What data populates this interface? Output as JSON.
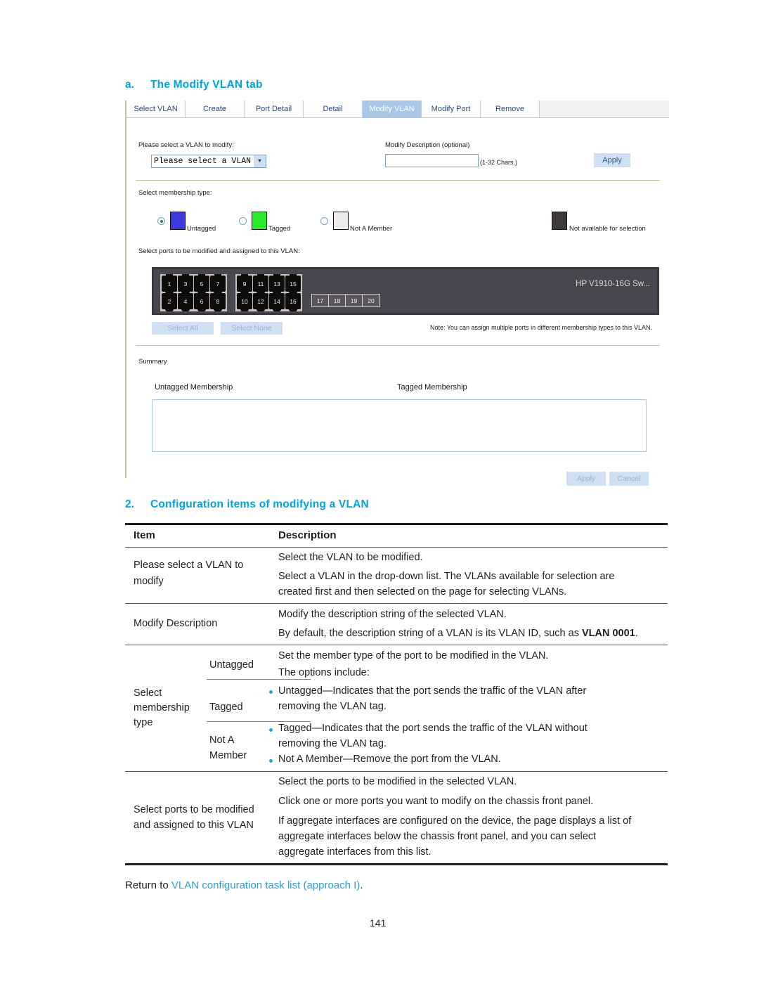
{
  "section_a": {
    "marker": "a.",
    "title": "The Modify VLAN tab"
  },
  "ui": {
    "tabs": [
      {
        "label": "Select VLAN",
        "selected": false
      },
      {
        "label": "Create",
        "selected": false
      },
      {
        "label": "Port Detail",
        "selected": false
      },
      {
        "label": "Detail",
        "selected": false
      },
      {
        "label": "Modify VLAN",
        "selected": true
      },
      {
        "label": "Modify Port",
        "selected": false
      },
      {
        "label": "Remove",
        "selected": false
      }
    ],
    "select_vlan_label": "Please select a VLAN to modify:",
    "select_vlan_value": "Please select a VLAN I",
    "modify_desc_label": "Modify Description (optional)",
    "modify_desc_value": "",
    "chars_hint": "(1-32 Chars.)",
    "apply_top_label": "Apply",
    "membership_label": "Select membership type:",
    "membership_options": [
      {
        "label": "Untagged",
        "color": "#3b3bdc",
        "selected": true
      },
      {
        "label": "Tagged",
        "color": "#2eea2e",
        "selected": false
      },
      {
        "label": "Not A Member",
        "color": "#eceaea",
        "selected": false
      }
    ],
    "not_available_label": "Not available for selection",
    "not_available_color": "#3f3b3b",
    "select_ports_label": "Select ports to be modified and assigned to this VLAN:",
    "chassis_name": "HP V1910-16G Sw...",
    "ports_top": [
      "1",
      "3",
      "5",
      "7"
    ],
    "ports_bottom": [
      "2",
      "4",
      "6",
      "8"
    ],
    "ports_top2": [
      "9",
      "11",
      "13",
      "15"
    ],
    "ports_bottom2": [
      "10",
      "12",
      "14",
      "16"
    ],
    "sfp_ports": [
      "17",
      "18",
      "19",
      "20"
    ],
    "select_all_label": "Select All",
    "select_none_label": "Select None",
    "note": "Note: You can assign multiple ports in different membership types to this VLAN.",
    "summary_label": "Summary",
    "untagged_membership_label": "Untagged Membership",
    "tagged_membership_label": "Tagged Membership",
    "summary_value": "",
    "apply_label": "Apply",
    "cancel_label": "Cancel"
  },
  "section_2": {
    "marker": "2.",
    "title": "Configuration items of modifying a VLAN"
  },
  "table": {
    "headers": {
      "item": "Item",
      "description": "Description"
    },
    "rows": [
      {
        "item": [
          "Please select a VLAN to",
          "modify"
        ],
        "desc": [
          "Select the VLAN to be modified.",
          "Select a VLAN in the drop-down list. The VLANs available for selection are",
          "created first and then selected on the page for selecting VLANs."
        ]
      },
      {
        "item": [
          "Modify Description"
        ],
        "desc": [
          "Modify the description string of the selected VLAN.",
          "By default, the description string of a VLAN is its VLAN ID, such as ",
          "VLAN 0001",
          "."
        ]
      },
      {
        "item": [
          "Select",
          "membership",
          "type"
        ],
        "sub": [
          "Untagged",
          "Tagged",
          "Not A",
          "Member"
        ],
        "desc": [
          "Set the member type of the port to be modified in the VLAN.",
          "The options include:"
        ],
        "bullets": [
          [
            "Untagged—Indicates that the port sends the traffic of the VLAN after",
            "removing the VLAN tag."
          ],
          [
            "Tagged—Indicates that the port sends the traffic of the VLAN without",
            "removing the VLAN tag."
          ],
          [
            "Not A Member—Remove the port from the VLAN."
          ]
        ]
      },
      {
        "item": [
          "Select ports to be modified",
          "and assigned to this VLAN"
        ],
        "desc": [
          "Select the ports to be modified in the selected VLAN.",
          "Click one or more ports you want to modify on the chassis front panel.",
          "If aggregate interfaces are configured on the device, the page displays a list of",
          "aggregate interfaces below the chassis front panel, and you can select",
          "aggregate interfaces from this list."
        ]
      }
    ]
  },
  "footer": {
    "return_prefix": "Return to ",
    "return_link": "VLAN configuration task list (approach I)",
    "return_suffix": ".",
    "page_number": "141"
  }
}
